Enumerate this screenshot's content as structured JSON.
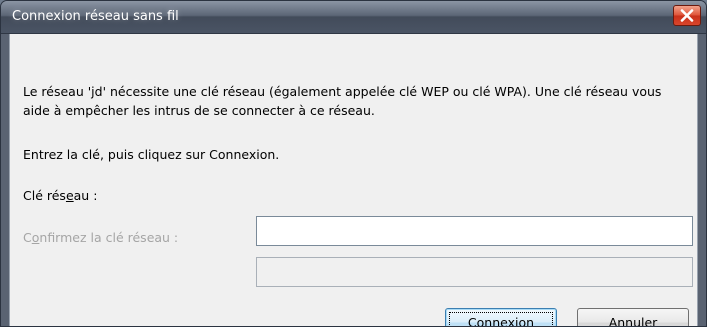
{
  "window": {
    "title": "Connexion réseau sans fil",
    "close_glyph": "✕"
  },
  "dialog": {
    "message": "Le réseau 'jd' nécessite une clé réseau (également appelée clé WEP ou clé WPA). Une clé réseau vous aide à empêcher les intrus de se connecter à ce réseau.",
    "instruction": "Entrez la clé, puis cliquez sur Connexion.",
    "network_key": {
      "label_pre": "Clé rés",
      "label_accel": "e",
      "label_post": "au :",
      "value": ""
    },
    "confirm_key": {
      "label_pre": "C",
      "label_accel": "o",
      "label_post": "nfirmez la clé réseau :",
      "value": "",
      "disabled": true
    }
  },
  "buttons": {
    "connect": {
      "accel": "C",
      "rest": "onnexion"
    },
    "cancel": {
      "label": "Annuler"
    }
  },
  "colors": {
    "close_button": "#d9462c",
    "default_button_border": "#3c7fb1",
    "disabled_text": "#a5a5a5"
  }
}
